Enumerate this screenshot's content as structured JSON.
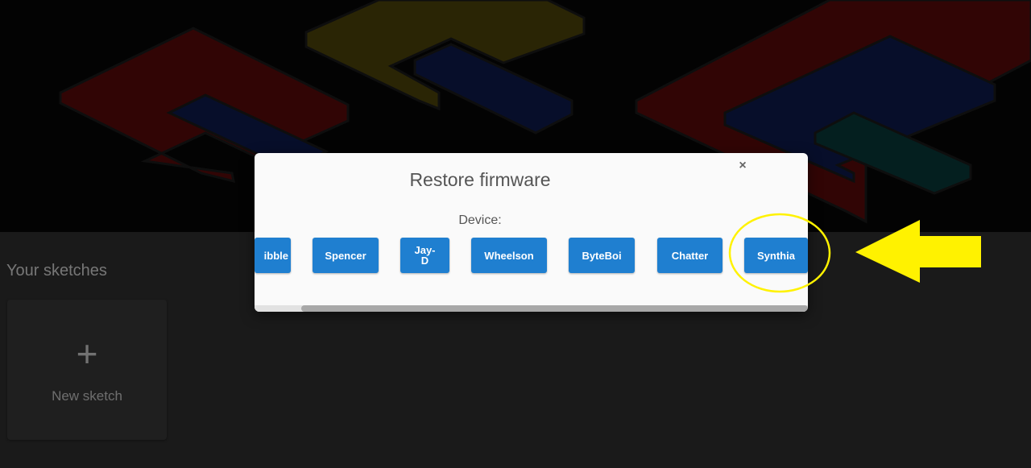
{
  "sketches": {
    "section_title": "Your sketches",
    "new_sketch_label": "New sketch",
    "new_sketch_icon": "plus-icon"
  },
  "modal": {
    "title": "Restore firmware",
    "close_icon": "close-icon",
    "close_glyph": "×",
    "device_label": "Device:",
    "devices": [
      {
        "label": "ibble"
      },
      {
        "label": "Spencer"
      },
      {
        "label": "Jay-D"
      },
      {
        "label": "Wheelson"
      },
      {
        "label": "ByteBoi"
      },
      {
        "label": "Chatter"
      },
      {
        "label": "Synthia"
      }
    ]
  },
  "annotation": {
    "highlight": "Synthia",
    "highlight_color": "#fff200",
    "arrow_color": "#fff200"
  },
  "colors": {
    "button_blue": "#1f7fd0",
    "modal_bg": "#fafafa",
    "page_bg": "#303030"
  }
}
